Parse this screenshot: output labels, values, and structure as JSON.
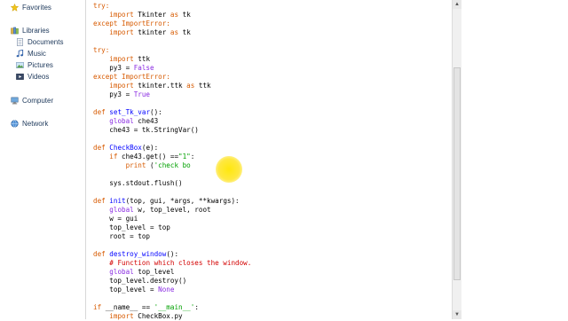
{
  "nav": {
    "favorites": "Favorites",
    "libraries": "Libraries",
    "documents": "Documents",
    "music": "Music",
    "pictures": "Pictures",
    "videos": "Videos",
    "computer": "Computer",
    "network": "Network"
  },
  "code_lines": [
    [
      {
        "t": "try:",
        "c": "kw"
      }
    ],
    [
      {
        "t": "    "
      },
      {
        "t": "import",
        "c": "kw"
      },
      {
        "t": " Tkinter "
      },
      {
        "t": "as",
        "c": "kw"
      },
      {
        "t": " tk"
      }
    ],
    [
      {
        "t": "except ImportError:",
        "c": "kw"
      }
    ],
    [
      {
        "t": "    "
      },
      {
        "t": "import",
        "c": "kw"
      },
      {
        "t": " tkinter "
      },
      {
        "t": "as",
        "c": "kw"
      },
      {
        "t": " tk"
      }
    ],
    [
      {
        "t": ""
      }
    ],
    [
      {
        "t": "try:",
        "c": "kw"
      }
    ],
    [
      {
        "t": "    "
      },
      {
        "t": "import",
        "c": "kw"
      },
      {
        "t": " ttk"
      }
    ],
    [
      {
        "t": "    py3 = "
      },
      {
        "t": "False",
        "c": "bi"
      }
    ],
    [
      {
        "t": "except ImportError:",
        "c": "kw"
      }
    ],
    [
      {
        "t": "    "
      },
      {
        "t": "import",
        "c": "kw"
      },
      {
        "t": " tkinter.ttk "
      },
      {
        "t": "as",
        "c": "kw"
      },
      {
        "t": " ttk"
      }
    ],
    [
      {
        "t": "    py3 = "
      },
      {
        "t": "True",
        "c": "bi"
      }
    ],
    [
      {
        "t": ""
      }
    ],
    [
      {
        "t": "def ",
        "c": "def"
      },
      {
        "t": "set_Tk_var",
        "c": "fn"
      },
      {
        "t": "():"
      }
    ],
    [
      {
        "t": "    "
      },
      {
        "t": "global",
        "c": "bi"
      },
      {
        "t": " che43"
      }
    ],
    [
      {
        "t": "    che43 = tk.StringVar()"
      }
    ],
    [
      {
        "t": ""
      }
    ],
    [
      {
        "t": "def ",
        "c": "def"
      },
      {
        "t": "CheckBox",
        "c": "fn"
      },
      {
        "t": "(e):"
      }
    ],
    [
      {
        "t": "    "
      },
      {
        "t": "if",
        "c": "kw"
      },
      {
        "t": " che43.get() =="
      },
      {
        "t": "\"1\"",
        "c": "st"
      },
      {
        "t": ":"
      }
    ],
    [
      {
        "t": "        "
      },
      {
        "t": "print",
        "c": "kw"
      },
      {
        "t": " ("
      },
      {
        "t": "'check bo",
        "c": "st"
      }
    ],
    [
      {
        "t": ""
      }
    ],
    [
      {
        "t": "    sys.stdout.flush()"
      }
    ],
    [
      {
        "t": ""
      }
    ],
    [
      {
        "t": "def ",
        "c": "def"
      },
      {
        "t": "init",
        "c": "fn"
      },
      {
        "t": "(top, gui, *args, **kwargs):"
      }
    ],
    [
      {
        "t": "    "
      },
      {
        "t": "global",
        "c": "bi"
      },
      {
        "t": " w, top_level, root"
      }
    ],
    [
      {
        "t": "    w = gui"
      }
    ],
    [
      {
        "t": "    top_level = top"
      }
    ],
    [
      {
        "t": "    root = top"
      }
    ],
    [
      {
        "t": ""
      }
    ],
    [
      {
        "t": "def ",
        "c": "def"
      },
      {
        "t": "destroy_window",
        "c": "fn"
      },
      {
        "t": "():"
      }
    ],
    [
      {
        "t": "    "
      },
      {
        "t": "# Function which closes the window.",
        "c": "cm"
      }
    ],
    [
      {
        "t": "    "
      },
      {
        "t": "global",
        "c": "bi"
      },
      {
        "t": " top_level"
      }
    ],
    [
      {
        "t": "    top_level.destroy()"
      }
    ],
    [
      {
        "t": "    top_level = "
      },
      {
        "t": "None",
        "c": "bi"
      }
    ],
    [
      {
        "t": ""
      }
    ],
    [
      {
        "t": "if",
        "c": "kw"
      },
      {
        "t": " __name__ == "
      },
      {
        "t": "'__main__'",
        "c": "st"
      },
      {
        "t": ":"
      }
    ],
    [
      {
        "t": "    "
      },
      {
        "t": "import",
        "c": "kw"
      },
      {
        "t": " CheckBox.py"
      }
    ]
  ],
  "colors": {
    "keyword": "#d75a00",
    "builtin": "#8a2be2",
    "string": "#00a000",
    "comment": "#d30000",
    "function_name": "#0000ff",
    "cursor_highlight": "#ffe000"
  },
  "icons": {
    "favorites": "star-icon",
    "libraries": "libraries-icon",
    "documents": "document-icon",
    "music": "music-icon",
    "pictures": "picture-icon",
    "videos": "video-icon",
    "computer": "computer-icon",
    "network": "network-icon"
  }
}
